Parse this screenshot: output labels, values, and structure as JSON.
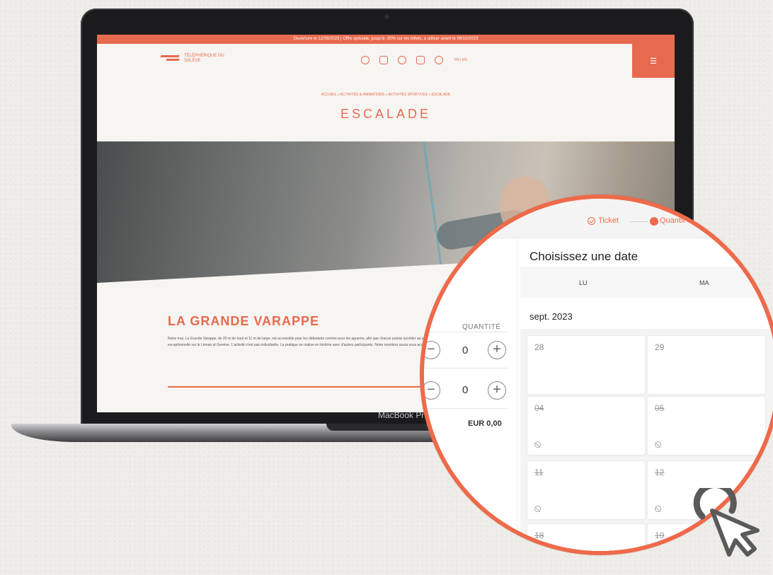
{
  "laptop": {
    "model_label": "MacBook Pro"
  },
  "site": {
    "promo_text": "Ouverture le 12/08/2023 | Offre spéciale, jusqu'à -30% sur les billets, à utiliser avant le 08/10/2023",
    "logo_text": "TÉLÉPHÉRIQUE DU SALÈVE",
    "lang_text": "FR | EN",
    "menu_icon": "☰",
    "breadcrumb": "ACCUEIL » ACTIVITÉS & ANIMATIONS » ACTIVITÉS SPORTIVES » ESCALADE",
    "page_title": "ESCALADE",
    "section_title": "LA GRANDE VARAPPE",
    "section_text": "Notre mur, La Grande Varappe, de 20 m de haut et 11 m de large, est accessible pour les débutants comme pour les aguerris, afin que chacun puisse accéder au sommet et profiter de la vue exceptionnelle sur le Léman et Genève. L'activité n'est pas individuelle. La pratique se réalise en binôme avec d'autres participants. Notre moniteur saura vous accompagner durant votre activité.",
    "header_icons": [
      "ticket-icon",
      "tag-icon",
      "group-icon",
      "document-icon",
      "heart-icon"
    ]
  },
  "booking": {
    "steps": [
      {
        "label": "Ticket",
        "state": "done"
      },
      {
        "label": "Quantit",
        "state": "active"
      }
    ],
    "quantity_header": "QUANTITÉ",
    "rows": [
      {
        "minus": "−",
        "value": "0",
        "plus": "+"
      },
      {
        "minus": "−",
        "value": "0",
        "plus": "+"
      }
    ],
    "total": "EUR 0,00",
    "calendar_title": "Choisissez une date",
    "weekdays": [
      "LU",
      "MA"
    ],
    "month": "sept. 2023",
    "days": [
      {
        "num": "28",
        "blocked": false
      },
      {
        "num": "29",
        "blocked": false
      },
      {
        "num": "04",
        "blocked": true
      },
      {
        "num": "05",
        "blocked": true
      },
      {
        "num": "11",
        "blocked": true
      },
      {
        "num": "12",
        "blocked": true
      },
      {
        "num": "18",
        "blocked": true
      },
      {
        "num": "19",
        "blocked": true
      }
    ]
  },
  "colors": {
    "brand": "#e76a4e",
    "ring": "#ee6a4a"
  }
}
